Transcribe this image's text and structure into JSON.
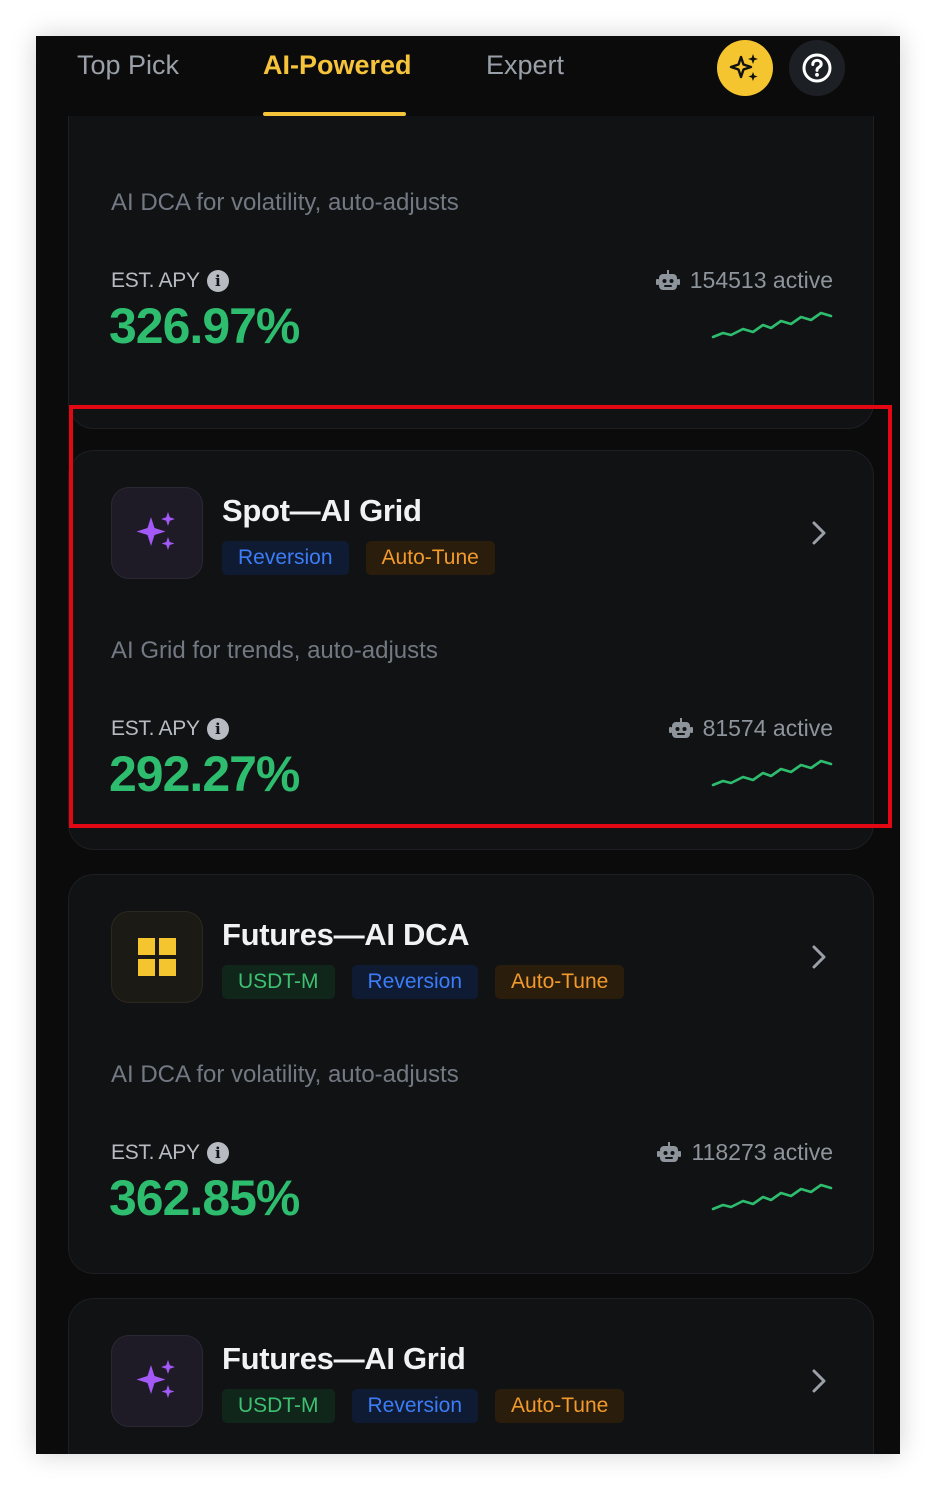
{
  "tabs": {
    "items": [
      "Top Pick",
      "AI-Powered",
      "Expert"
    ],
    "active": "AI-Powered"
  },
  "header_icons": {
    "ai_button": "sparkle-icon",
    "help_button": "question-icon"
  },
  "colors": {
    "accent": "#f6c43a",
    "apy_green": "#2ebd6f",
    "highlight_red": "#e30613",
    "tag_blue": "#3c7cf6",
    "tag_orange": "#f29a2b",
    "tag_green": "#3fbf72"
  },
  "cards": [
    {
      "desc": "AI DCA for volatility, auto-adjusts",
      "apy_label": "EST. APY",
      "apy_value": "326.97%",
      "active": "154513 active"
    },
    {
      "title": "Spot—AI Grid",
      "icon": "sparkle-icon",
      "tags": [
        "Reversion",
        "Auto-Tune"
      ],
      "desc": "AI Grid for trends, auto-adjusts",
      "apy_label": "EST. APY",
      "apy_value": "292.27%",
      "active": "81574 active"
    },
    {
      "title": "Futures—AI DCA",
      "icon": "grid-icon",
      "tags": [
        "USDT-M",
        "Reversion",
        "Auto-Tune"
      ],
      "desc": "AI DCA for volatility, auto-adjusts",
      "apy_label": "EST. APY",
      "apy_value": "362.85%",
      "active": "118273 active"
    },
    {
      "title": "Futures—AI Grid",
      "icon": "sparkle-icon",
      "tags": [
        "USDT-M",
        "Reversion",
        "Auto-Tune"
      ]
    }
  ]
}
